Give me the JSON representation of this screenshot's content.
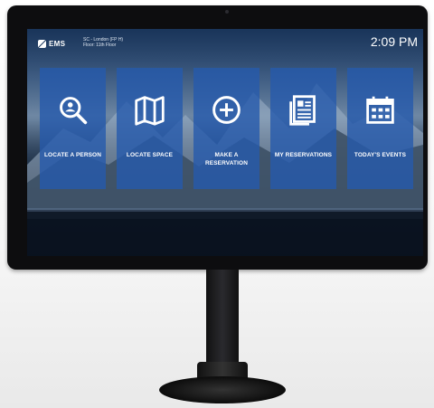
{
  "header": {
    "logo_text": "EMS",
    "location_line1": "SC - London (FP H)",
    "location_line2": "Floor: 11th Floor",
    "time": "2:09 PM"
  },
  "tiles": [
    {
      "label": "LOCATE A PERSON",
      "icon": "search-person-icon"
    },
    {
      "label": "LOCATE SPACE",
      "icon": "map-icon"
    },
    {
      "label": "MAKE A RESERVATION",
      "icon": "plus-circle-icon"
    },
    {
      "label": "MY RESERVATIONS",
      "icon": "document-icon"
    },
    {
      "label": "TODAY'S EVENTS",
      "icon": "calendar-icon"
    }
  ],
  "colors": {
    "tile": "#255aac",
    "bezel": "#0d0d0f"
  }
}
